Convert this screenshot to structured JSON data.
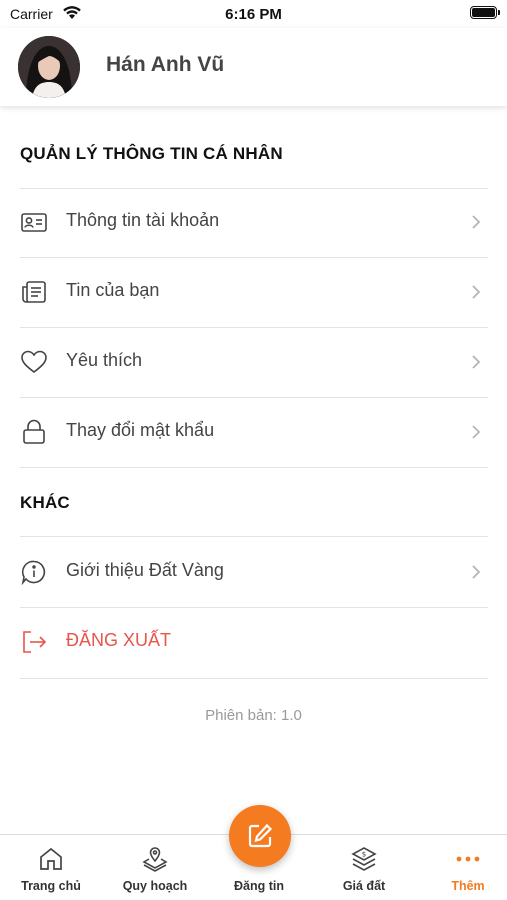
{
  "status_bar": {
    "carrier": "Carrier",
    "time": "6:16 PM"
  },
  "profile": {
    "name": "Hán Anh Vũ"
  },
  "sections": {
    "personal": {
      "title": "QUẢN LÝ THÔNG TIN CÁ NHÂN",
      "items": [
        {
          "label": "Thông tin tài khoản",
          "icon": "id-card-icon"
        },
        {
          "label": "Tin của bạn",
          "icon": "news-icon"
        },
        {
          "label": "Yêu thích",
          "icon": "heart-icon"
        },
        {
          "label": "Thay đổi mật khẩu",
          "icon": "lock-icon"
        }
      ]
    },
    "other": {
      "title": "KHÁC",
      "items": [
        {
          "label": "Giới thiệu Đất Vàng",
          "icon": "info-icon"
        }
      ]
    }
  },
  "logout": {
    "label": "ĐĂNG XUẤT",
    "color": "#e8554a"
  },
  "version": "Phiên bản: 1.0",
  "tab_bar": {
    "accent_color": "#f47b20",
    "tabs": [
      {
        "label": "Trang chủ",
        "icon": "home-icon"
      },
      {
        "label": "Quy hoạch",
        "icon": "map-pin-icon"
      },
      {
        "label": "Đăng tin",
        "icon": "edit-icon"
      },
      {
        "label": "Giá đất",
        "icon": "layers-dollar-icon"
      },
      {
        "label": "Thêm",
        "icon": "more-dots-icon",
        "active": true
      }
    ]
  }
}
